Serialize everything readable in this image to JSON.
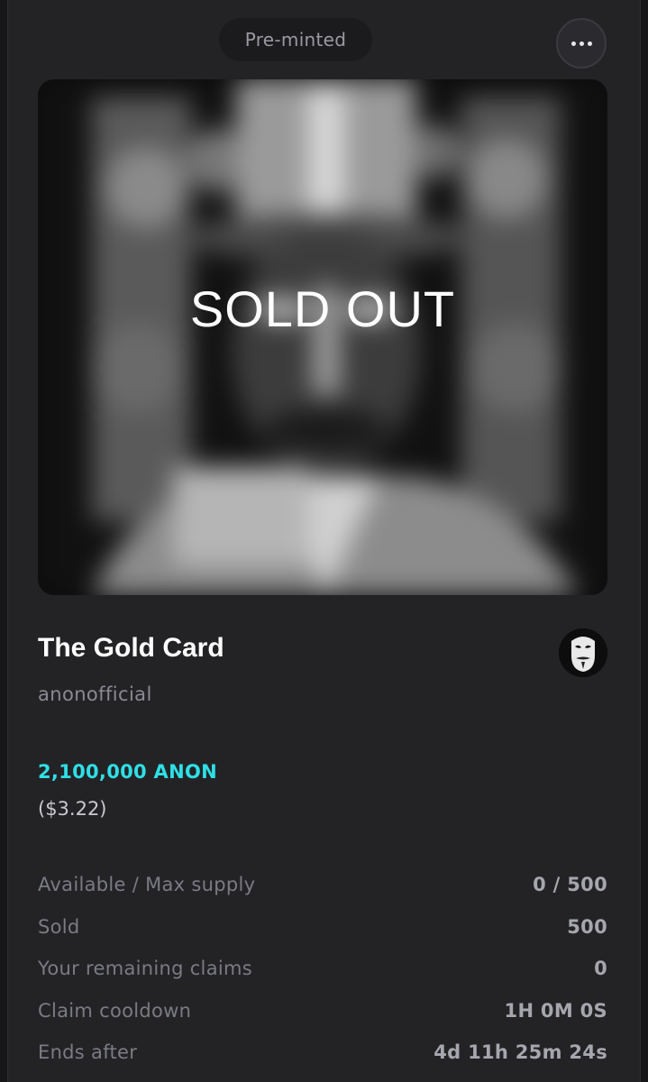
{
  "header": {
    "status_badge": "Pre-minted",
    "more_icon": "more-horizontal-icon"
  },
  "artwork": {
    "overlay_text": "SOLD OUT"
  },
  "nft": {
    "title": "The Gold Card",
    "creator": "anonofficial",
    "creator_avatar_icon": "guy-fawkes-mask-avatar"
  },
  "pricing": {
    "token_price": "2,100,000 ANON",
    "usd_price": "($3.22)",
    "accent_color": "#2ee0e6"
  },
  "stats": [
    {
      "label": "Available / Max supply",
      "value": "0 / 500"
    },
    {
      "label": "Sold",
      "value": "500"
    },
    {
      "label": "Your remaining claims",
      "value": "0"
    },
    {
      "label": "Claim cooldown",
      "value": "1H 0M 0S"
    },
    {
      "label": "Ends after",
      "value": "4d 11h 25m 24s"
    }
  ]
}
